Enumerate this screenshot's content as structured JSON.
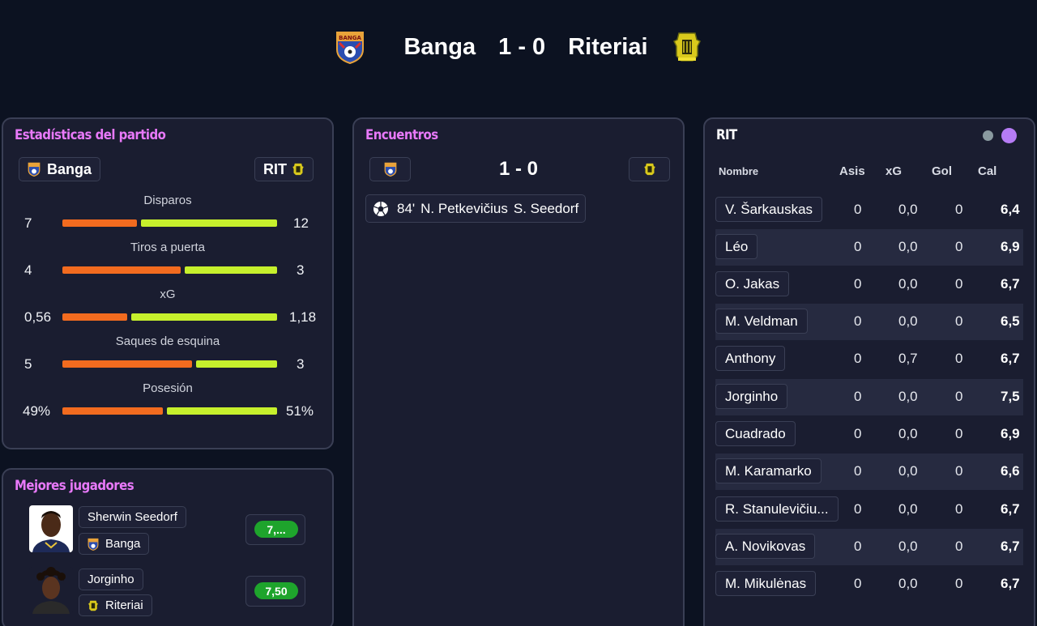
{
  "match": {
    "home_team": "Banga",
    "away_team": "Riteriai",
    "score": "1 - 0",
    "home_crest_text": "BANGA"
  },
  "colors": {
    "home": "#f26b1f",
    "away": "#c6f02c",
    "accent": "#e879f9",
    "rating_good": "#1ea42c"
  },
  "stats_panel": {
    "title": "Estadísticas del partido",
    "home_chip": "Banga",
    "away_chip": "RIT",
    "stats": [
      {
        "label": "Disparos",
        "home": "7",
        "away": "12",
        "home_share": 0.35
      },
      {
        "label": "Tiros a puerta",
        "home": "4",
        "away": "3",
        "home_share": 0.56
      },
      {
        "label": "xG",
        "home": "0,56",
        "away": "1,18",
        "home_share": 0.31
      },
      {
        "label": "Saques de esquina",
        "home": "5",
        "away": "3",
        "home_share": 0.62
      },
      {
        "label": "Posesión",
        "home": "49%",
        "away": "51%",
        "home_share": 0.48
      }
    ]
  },
  "players_panel": {
    "title": "Mejores jugadores",
    "players": [
      {
        "name": "Sherwin Seedorf",
        "team": "Banga",
        "rating": "7,..."
      },
      {
        "name": "Jorginho",
        "team": "Riteriai",
        "rating": "7,50"
      }
    ]
  },
  "events_panel": {
    "title": "Encuentros",
    "score": "1 - 0",
    "events": [
      {
        "minute": "84'",
        "scorer": "N. Petkevičius",
        "assist": "S. Seedorf",
        "icon": "soccer-ball-icon"
      }
    ]
  },
  "lineup_panel": {
    "title": "RIT",
    "columns": [
      "Nombre",
      "Asis",
      "xG",
      "Gol",
      "Cal"
    ],
    "rows": [
      {
        "name": "V. Šarkauskas",
        "asis": "0",
        "xg": "0,0",
        "gol": "0",
        "cal": "6,4"
      },
      {
        "name": "Léo",
        "asis": "0",
        "xg": "0,0",
        "gol": "0",
        "cal": "6,9"
      },
      {
        "name": "O. Jakas",
        "asis": "0",
        "xg": "0,0",
        "gol": "0",
        "cal": "6,7"
      },
      {
        "name": "M. Veldman",
        "asis": "0",
        "xg": "0,0",
        "gol": "0",
        "cal": "6,5"
      },
      {
        "name": "Anthony",
        "asis": "0",
        "xg": "0,7",
        "gol": "0",
        "cal": "6,7"
      },
      {
        "name": "Jorginho",
        "asis": "0",
        "xg": "0,0",
        "gol": "0",
        "cal": "7,5"
      },
      {
        "name": "Cuadrado",
        "asis": "0",
        "xg": "0,0",
        "gol": "0",
        "cal": "6,9"
      },
      {
        "name": "M. Karamarko",
        "asis": "0",
        "xg": "0,0",
        "gol": "0",
        "cal": "6,6"
      },
      {
        "name": "R. Stanulevičiu...",
        "asis": "0",
        "xg": "0,0",
        "gol": "0",
        "cal": "6,7"
      },
      {
        "name": "A. Novikovas",
        "asis": "0",
        "xg": "0,0",
        "gol": "0",
        "cal": "6,7"
      },
      {
        "name": "M. Mikulėnas",
        "asis": "0",
        "xg": "0,0",
        "gol": "0",
        "cal": "6,7"
      }
    ]
  }
}
